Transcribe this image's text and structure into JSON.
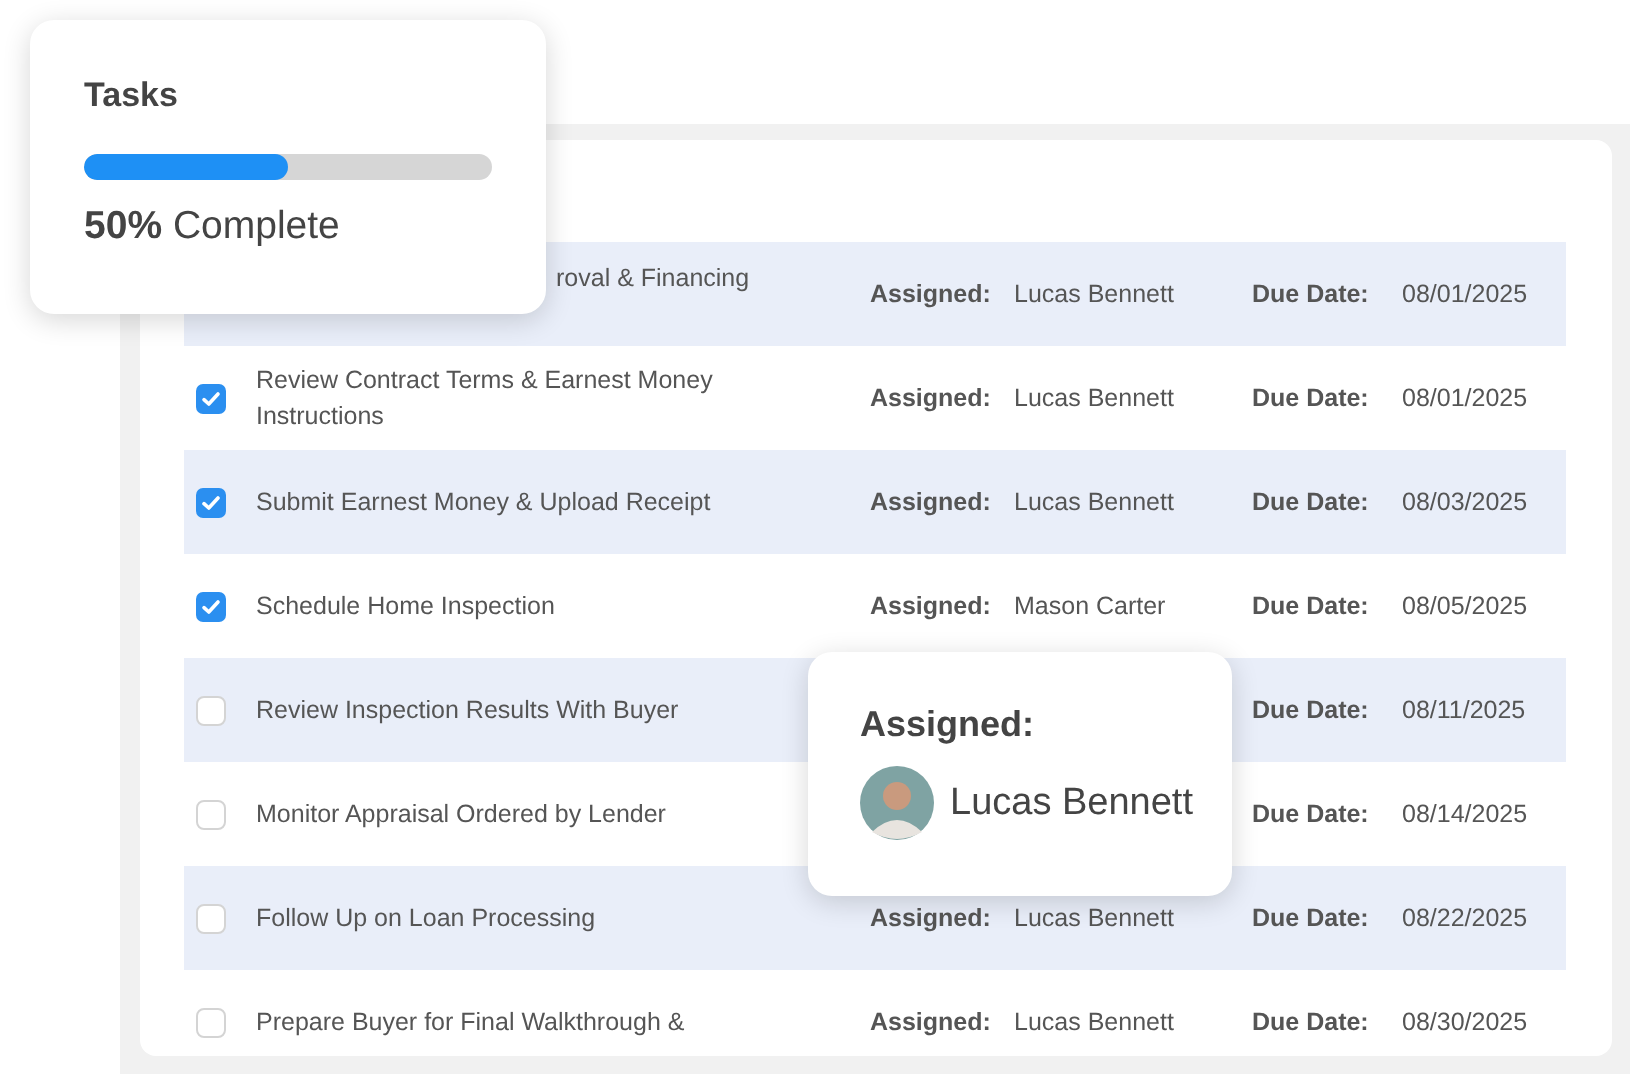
{
  "progress_card": {
    "title": "Tasks",
    "level": 0.5,
    "caption": "**50%** Complete"
  },
  "tasks": [
    {
      "kind": "covered",
      "title": "roval & Financing",
      "assigned_label": "Assigned:",
      "assignee": "Lucas Bennett",
      "due_label": "Due Date:",
      "due": "08/01/2025"
    },
    {
      "kind": "task",
      "checked": true,
      "title": "Review Contract Terms & Earnest Money Instructions",
      "assigned_label": "Assigned:",
      "assignee": "Lucas Bennett",
      "due_label": "Due Date:",
      "due": "08/01/2025"
    },
    {
      "kind": "task",
      "checked": true,
      "title": "Submit Earnest Money & Upload Receipt",
      "assigned_label": "Assigned:",
      "assignee": "Lucas Bennett",
      "due_label": "Due Date:",
      "due": "08/03/2025"
    },
    {
      "kind": "task",
      "checked": true,
      "title": "Schedule Home Inspection",
      "assigned_label": "Assigned:",
      "assignee": "Mason Carter",
      "due_label": "Due Date:",
      "due": "08/05/2025"
    },
    {
      "kind": "task",
      "checked": false,
      "title": "Review Inspection Results With Buyer",
      "due_label": "Due Date:",
      "due": "08/11/2025"
    },
    {
      "kind": "task",
      "checked": false,
      "title": "Monitor Appraisal Ordered by Lender",
      "due_label": "Due Date:",
      "due": "08/14/2025"
    },
    {
      "kind": "task",
      "checked": false,
      "title": "Follow Up on Loan Processing",
      "assigned_label": "Assigned:",
      "assignee": "Lucas Bennett",
      "due_label": "Due Date:",
      "due": "08/22/2025"
    },
    {
      "kind": "task",
      "checked": false,
      "title": "Prepare Buyer for Final Walkthrough &",
      "assigned_label": "Assigned:",
      "assignee": "Lucas Bennett",
      "due_label": "Due Date:",
      "due": "08/30/2025"
    }
  ],
  "assignee_popup": {
    "label": "Assigned:",
    "name": "Lucas Bennett"
  }
}
